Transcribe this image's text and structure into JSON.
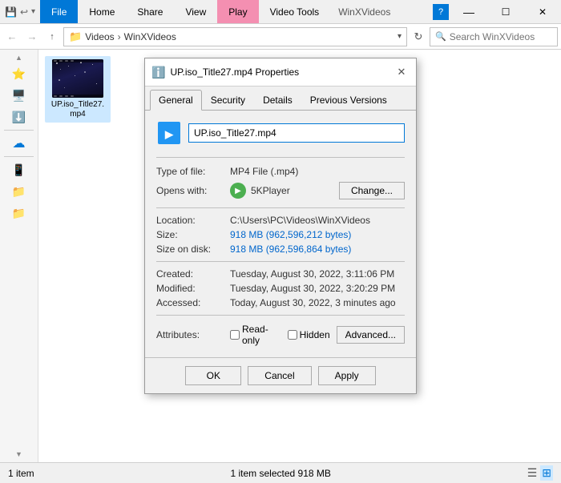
{
  "window": {
    "title": "WinXVideos",
    "min_label": "—",
    "max_label": "☐",
    "close_label": "✕"
  },
  "tabs": {
    "quick_access_icons": [
      "📋",
      "↩",
      "📋"
    ],
    "items": [
      {
        "label": "File",
        "active": false,
        "style": "file"
      },
      {
        "label": "Home",
        "active": false
      },
      {
        "label": "Share",
        "active": false
      },
      {
        "label": "View",
        "active": false
      },
      {
        "label": "Play",
        "active": true,
        "style": "play"
      },
      {
        "label": "Video Tools",
        "active": false
      },
      {
        "label": "WinXVideos",
        "active": false
      }
    ]
  },
  "address_bar": {
    "back_arrow": "←",
    "forward_arrow": "→",
    "up_arrow": "↑",
    "path_parts": [
      "Videos",
      "WinXVideos"
    ],
    "dropdown_arrow": "▾",
    "refresh": "↻",
    "search_placeholder": "Search WinXVideos"
  },
  "left_panel": {
    "icons": [
      "☆",
      "🖥",
      "📁",
      "☁",
      "📱",
      "📁",
      "📁"
    ],
    "scroll_up": "▲",
    "scroll_down": "▼"
  },
  "file_area": {
    "files": [
      {
        "name": "UP.iso_Title27.mp4",
        "selected": true
      }
    ]
  },
  "status_bar": {
    "count": "1 item",
    "selection": "1 item selected  918 MB",
    "view_list_icon": "☰",
    "view_grid_icon": "⊞"
  },
  "dialog": {
    "title": "UP.iso_Title27.mp4 Properties",
    "title_icon": "ℹ",
    "tabs": [
      "General",
      "Security",
      "Details",
      "Previous Versions"
    ],
    "active_tab": "General",
    "filename": "UP.iso_Title27.mp4",
    "type_label": "Type of file:",
    "type_value": "MP4 File (.mp4)",
    "opens_with_label": "Opens with:",
    "opens_with_value": "5KPlayer",
    "change_btn": "Change...",
    "location_label": "Location:",
    "location_value": "C:\\Users\\PC\\Videos\\WinXVideos",
    "size_label": "Size:",
    "size_value": "918 MB (962,596,212 bytes)",
    "size_disk_label": "Size on disk:",
    "size_disk_value": "918 MB (962,596,864 bytes)",
    "created_label": "Created:",
    "created_value": "Tuesday, August 30, 2022, 3:11:06 PM",
    "modified_label": "Modified:",
    "modified_value": "Tuesday, August 30, 2022, 3:20:29 PM",
    "accessed_label": "Accessed:",
    "accessed_value": "Today, August 30, 2022, 3 minutes ago",
    "attributes_label": "Attributes:",
    "readonly_label": "Read-only",
    "hidden_label": "Hidden",
    "advanced_btn": "Advanced...",
    "ok_btn": "OK",
    "cancel_btn": "Cancel",
    "apply_btn": "Apply"
  }
}
